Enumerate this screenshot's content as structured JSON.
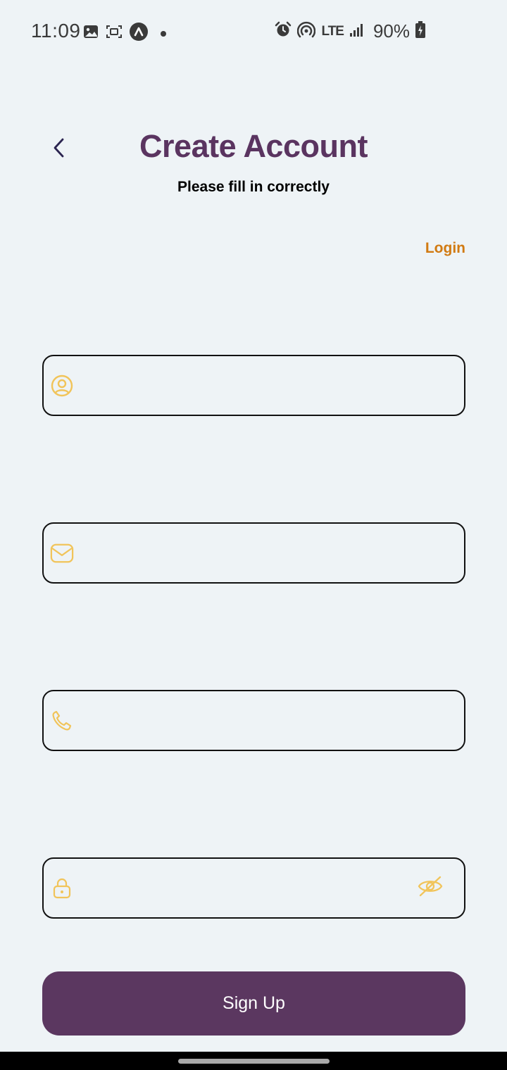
{
  "status_bar": {
    "time": "11:09",
    "network": "LTE",
    "battery": "90%"
  },
  "header": {
    "title": "Create Account",
    "subtitle": "Please fill in correctly",
    "login_label": "Login"
  },
  "form": {
    "name_value": "",
    "email_value": "",
    "phone_value": "",
    "password_value": ""
  },
  "signup_label": "Sign Up",
  "colors": {
    "background": "#eef3f6",
    "brand_purple": "#5b3760",
    "title_purple": "#5a3460",
    "login_orange": "#d17a12",
    "icon_yellow": "#f1c45a"
  },
  "icons": {
    "back": "chevron-left-icon",
    "name": "user-icon",
    "email": "mail-icon",
    "phone": "phone-icon",
    "password": "lock-icon",
    "toggle_visibility": "eye-off-icon"
  }
}
